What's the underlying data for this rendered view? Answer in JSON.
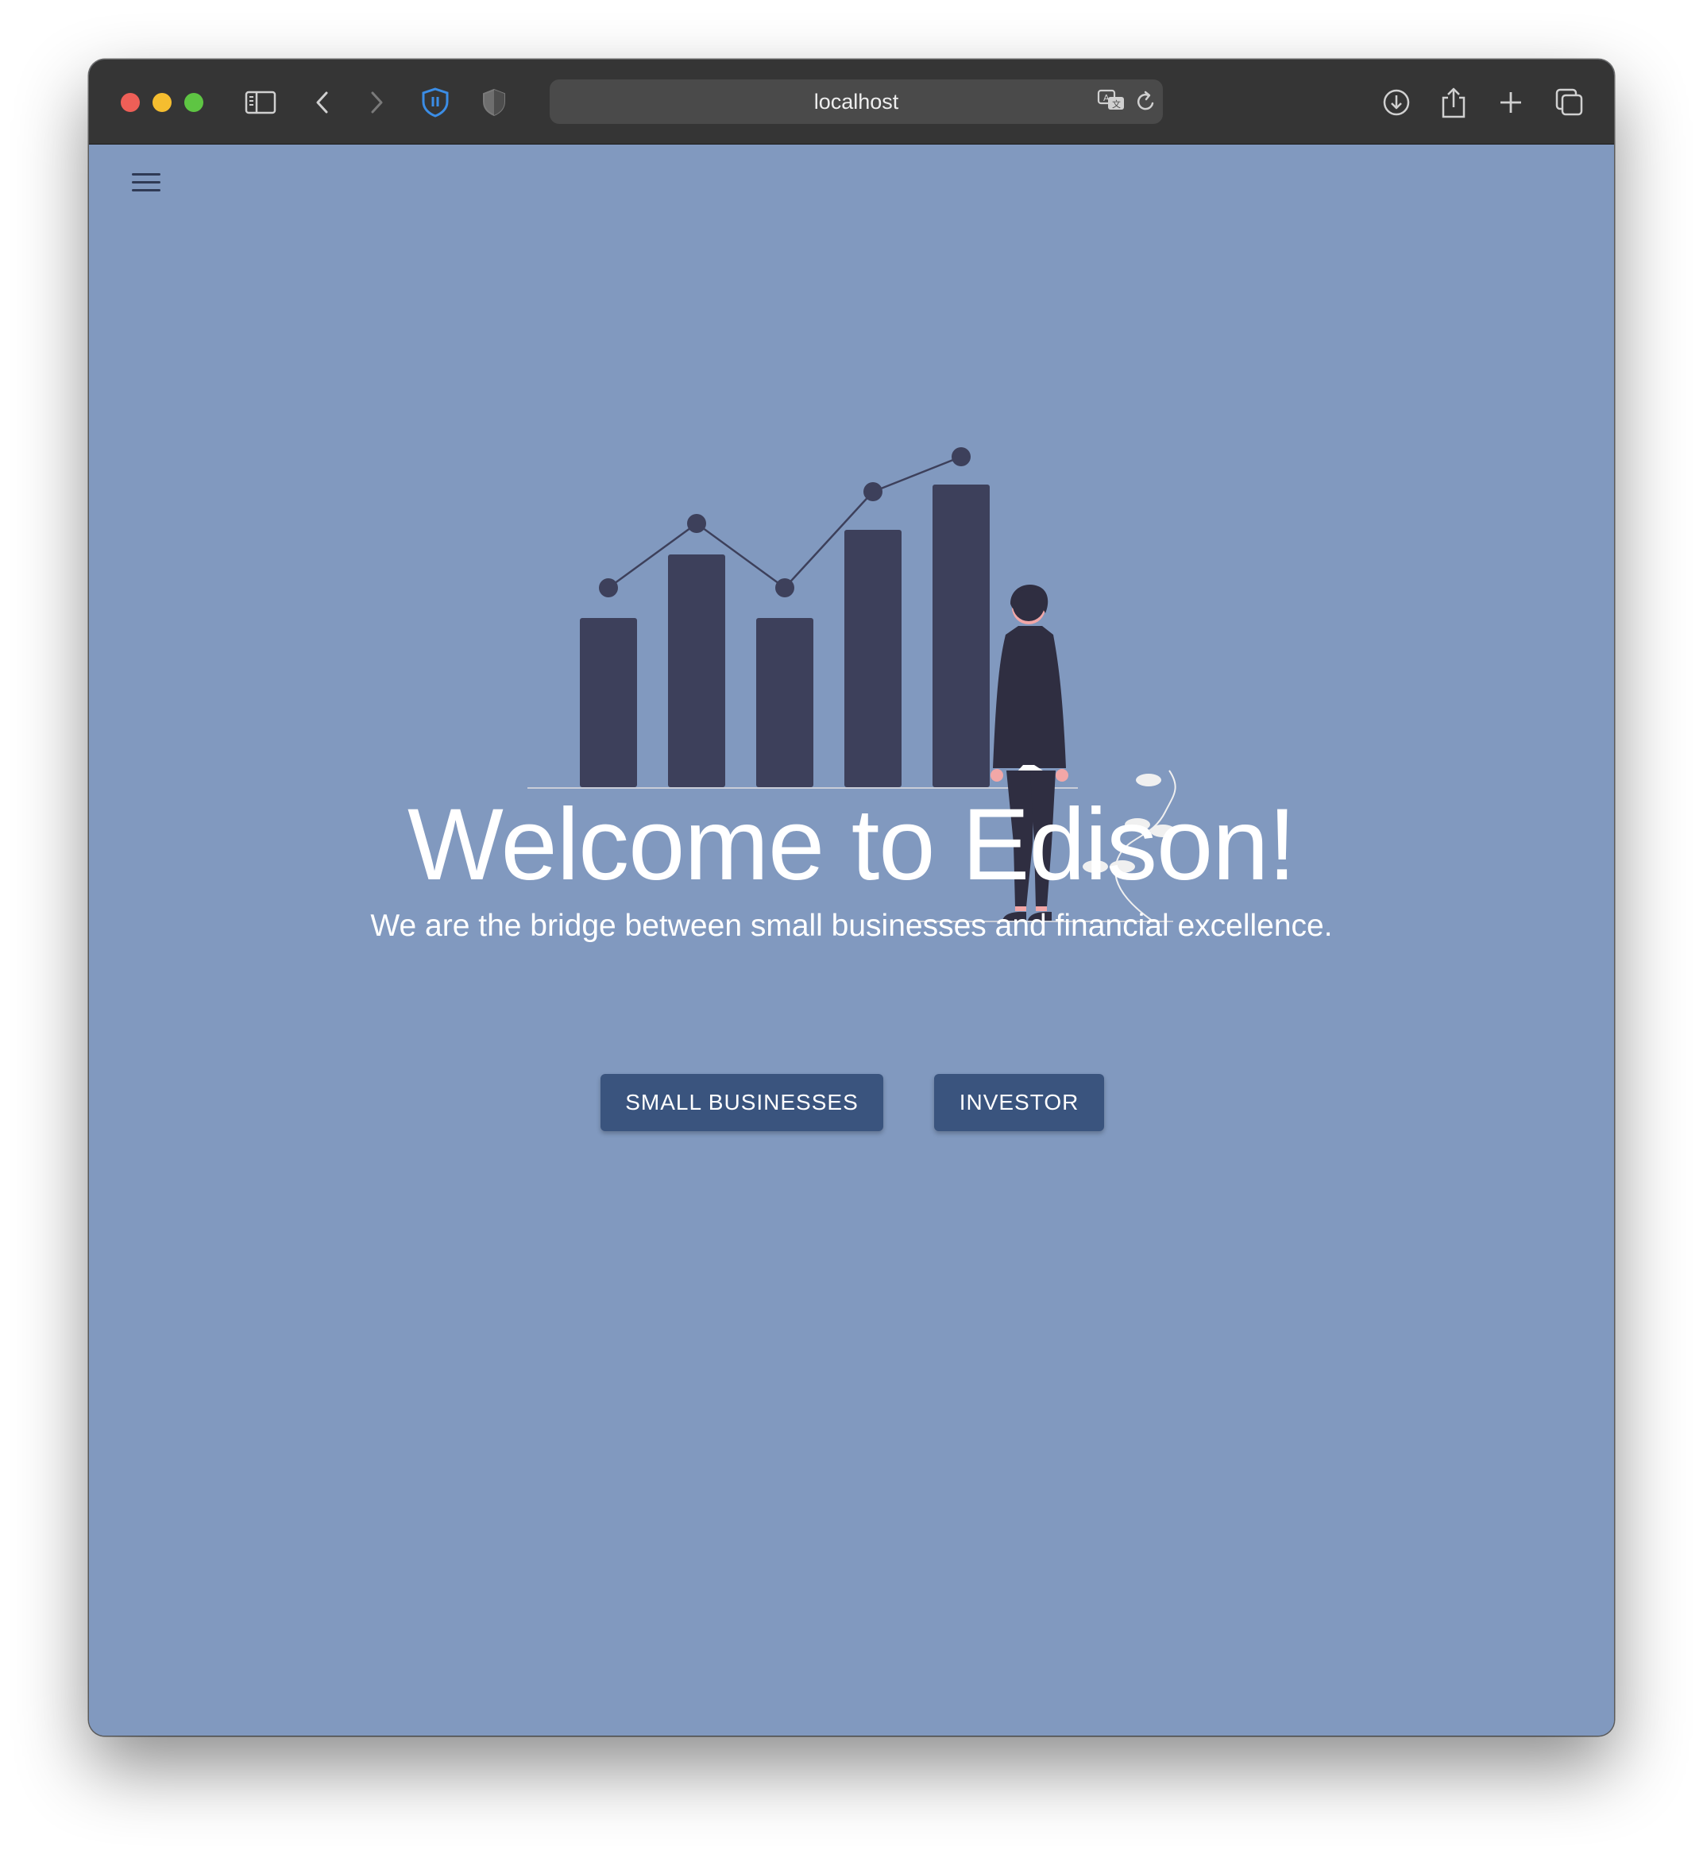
{
  "browser": {
    "address": "localhost",
    "icons": {
      "sidebar": "sidebar-toggle-icon",
      "back": "chevron-left-icon",
      "forward": "chevron-right-icon",
      "extension": "shield-extension-icon",
      "privacy": "privacy-shield-icon",
      "translate": "translate-icon",
      "reload": "reload-icon",
      "download": "download-icon",
      "share": "share-icon",
      "new_tab": "plus-icon",
      "tabs": "tab-overview-icon"
    }
  },
  "page": {
    "menu_icon": "hamburger-menu-icon",
    "headline": "Welcome to Edison!",
    "subtitle": "We are the bridge between small businesses and financial excellence.",
    "buttons": {
      "small_businesses": "SMALL BUSINESSES",
      "investor": "INVESTOR"
    },
    "colors": {
      "background": "#8199bf",
      "button": "#3a547e",
      "illustration_bars": "#3d405b",
      "person_suit": "#2f2e41"
    }
  }
}
